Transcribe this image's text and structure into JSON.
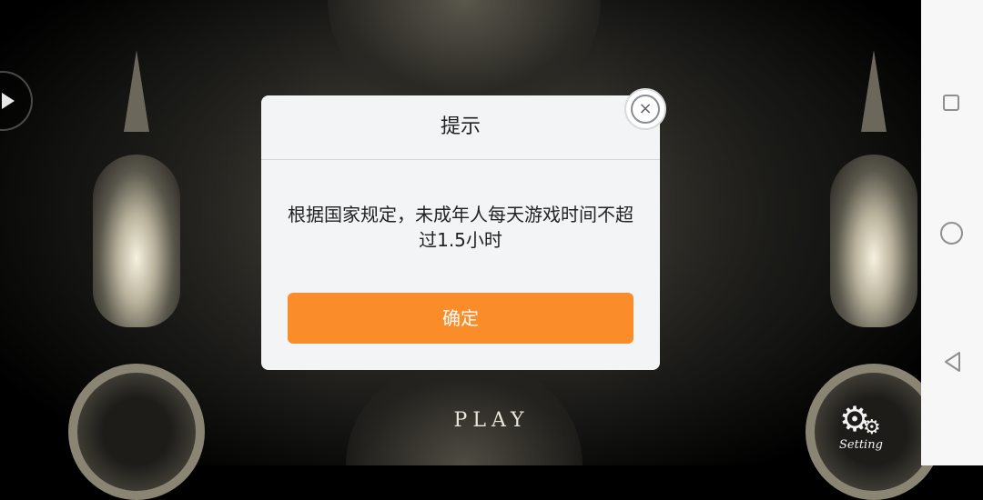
{
  "game": {
    "play_label": "PLAY",
    "setting_label": "Setting"
  },
  "dialog": {
    "title": "提示",
    "message": "根据国家规定，未成年人每天游戏时间不超过1.5小时",
    "confirm_label": "确定",
    "close_icon": "×"
  },
  "colors": {
    "confirm_button": "#fb8c2a",
    "dialog_background": "#f3f4f6"
  },
  "icons": {
    "side": "play-arrow-icon",
    "setting": "gear-icon",
    "close": "close-icon",
    "nav_recent": "square-icon",
    "nav_home": "circle-icon",
    "nav_back": "triangle-back-icon"
  }
}
